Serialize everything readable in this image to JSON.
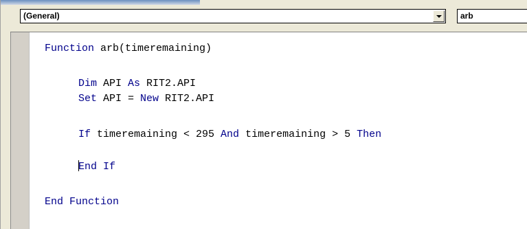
{
  "toolbar": {
    "object_combo": "(General)",
    "procedure_combo": "arb"
  },
  "code_lines": [
    {
      "parts": [
        {
          "t": "Function",
          "kw": true
        },
        {
          "t": " arb(timeremaining)",
          "kw": false
        }
      ]
    },
    {
      "parts": [
        {
          "t": "Dim",
          "kw": true
        },
        {
          "t": " API ",
          "kw": false
        },
        {
          "t": "As",
          "kw": true
        },
        {
          "t": " RIT2.API",
          "kw": false
        }
      ]
    },
    {
      "parts": [
        {
          "t": "Set",
          "kw": true
        },
        {
          "t": " API = ",
          "kw": false
        },
        {
          "t": "New",
          "kw": true
        },
        {
          "t": " RIT2.API",
          "kw": false
        }
      ]
    },
    {
      "parts": [
        {
          "t": "If",
          "kw": true
        },
        {
          "t": " timeremaining < 295 ",
          "kw": false
        },
        {
          "t": "And",
          "kw": true
        },
        {
          "t": " timeremaining > 5 ",
          "kw": false
        },
        {
          "t": "Then",
          "kw": true
        }
      ]
    },
    {
      "parts": [
        {
          "t": "End",
          "kw": true
        },
        {
          "t": " ",
          "kw": false
        },
        {
          "t": "If",
          "kw": true
        }
      ]
    },
    {
      "parts": [
        {
          "t": "End",
          "kw": true
        },
        {
          "t": " ",
          "kw": false
        },
        {
          "t": "Function",
          "kw": true
        }
      ]
    }
  ],
  "colors": {
    "keyword": "#00008b",
    "text": "#000000"
  }
}
